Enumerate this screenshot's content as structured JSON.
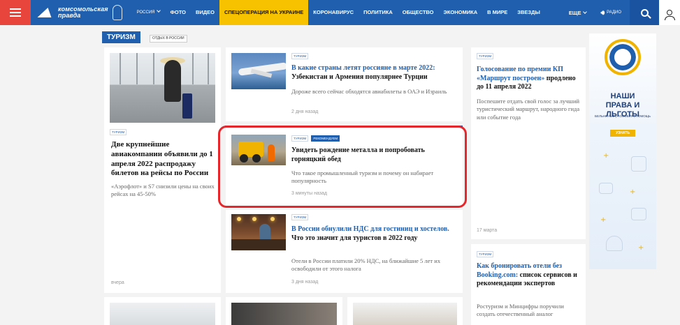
{
  "header": {
    "logo_line1": "комсомольская",
    "logo_line2": "правда",
    "region": "РОССИЯ",
    "nav": [
      {
        "label": "ФОТО"
      },
      {
        "label": "ВИДЕО"
      },
      {
        "label": "СПЕЦОПЕРАЦИЯ НА УКРАИНЕ"
      },
      {
        "label": "КОРОНАВИРУС"
      },
      {
        "label": "ПОЛИТИКА"
      },
      {
        "label": "ОБЩЕСТВО"
      },
      {
        "label": "ЭКОНОМИКА"
      },
      {
        "label": "В МИРЕ"
      },
      {
        "label": "ЗВЕЗДЫ"
      }
    ],
    "more_label": "ЕЩЕ",
    "radio_label": "РАДИО"
  },
  "section": {
    "title": "ТУРИЗМ",
    "subsection": "ОТДЫХ В РОССИИ"
  },
  "articles": {
    "airlines": {
      "tag": "ТУРИЗМ",
      "title": "Две крупнейшие авиакомпании объявили до 1 апреля 2022 распродажу билетов на рейсы по России",
      "lead": "«Аэрофлот» и S7 снизили цены на своих рейсах на 45-50%",
      "time": "вчера"
    },
    "countries": {
      "tag": "ТУРИЗМ",
      "title_blue": "В какие страны летят россияне в марте 2022:",
      "title_black": " Узбекистан и Армения популярнее Турции",
      "lead": "Дороже всего сейчас обходятся авиабилеты в ОАЭ и Израиль",
      "time": "2 дня назад"
    },
    "metal": {
      "tag": "ТУРИЗМ",
      "tag_rec": "РЕКОМЕНДУЕМ",
      "title": "Увидеть рождение металла и попробовать горняцкий обед",
      "lead": "Что такое промышленный туризм и почему он набирает популярность",
      "time": "3 минуты назад"
    },
    "vat": {
      "tag": "ТУРИЗМ",
      "title_blue": "В России обнулили НДС для гостиниц и хостелов.",
      "title_black": " Что это значит для туристов в 2022 году",
      "lead": "Отели в России платили 20% НДС, на ближайшие 5 лет их освободили от этого налога",
      "time": "3 дня назад"
    },
    "vote": {
      "tag": "ТУРИЗМ",
      "title_blue": "Голосование по премии КП «Маршрут построен»",
      "title_black": " продлено до 11 апреля 2022",
      "lead": "Поспешите отдать свой голос за лучший туристический маршрут, народного гида или событие года",
      "time": "17 марта"
    },
    "booking": {
      "tag": "ТУРИЗМ",
      "title_blue": "Как бронировать отели без Booking.com:",
      "title_black": " список сервисов и рекомендации экспертов",
      "lead": "Ростуризм и Минцифры поручили создать отечественный аналог"
    }
  },
  "ad": {
    "title_line1": "НАШИ",
    "title_line2": "ПРАВА И ЛЬГОТЫ",
    "subtitle": "БЕЛЬНИНЫЕ | ПОСОБИЯ | ПОМОЩЬ",
    "cta": "УЗНАТЬ"
  },
  "colors": {
    "brand_blue": "#1f5fae",
    "burger_red": "#e8453c",
    "highlight_yellow": "#f7c300",
    "annotation_red": "#e5262b"
  }
}
